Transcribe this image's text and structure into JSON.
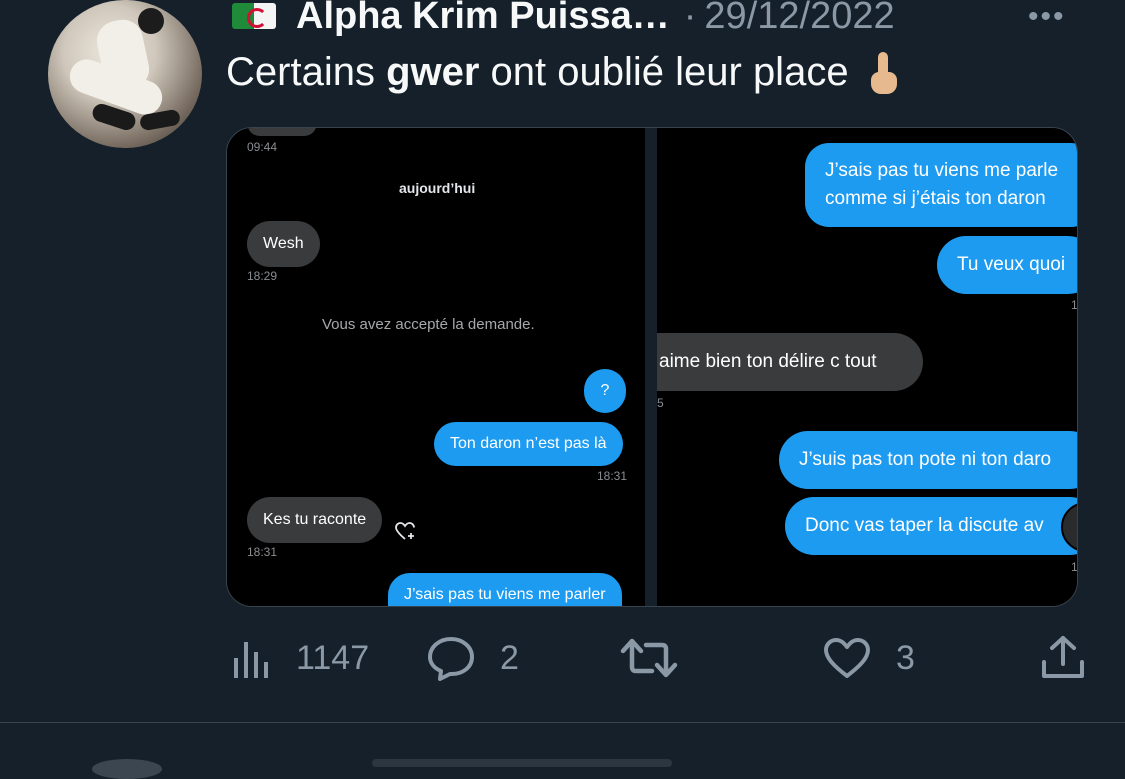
{
  "tweet": {
    "author_name": "Alpha Krim Puissa…",
    "separator": "·",
    "date": "29/12/2022",
    "more_label": "•••",
    "text_before": "Certains ",
    "text_bold": "gwer",
    "text_after": " ont oublié leur place",
    "emoji": "middle-finger-emoji"
  },
  "left_chat": {
    "top_time": "09:44",
    "day_label": "aujourd’hui",
    "msg_wesh": "Wesh",
    "time_wesh": "18:29",
    "system_msg": "Vous avez accepté la demande.",
    "msg_question": "?",
    "msg_daron": "Ton daron n’est pas là",
    "time_daron": "18:31",
    "msg_kes": "Kes tu raconte",
    "time_kes": "18:31",
    "msg_parler": "J’sais pas tu viens me parler"
  },
  "right_chat": {
    "msg_parler_line1": "J’sais pas tu viens me parle",
    "msg_parler_line2": "comme si j’étais ton daron",
    "msg_veux": "Tu veux quoi",
    "time_fragment_1": "1",
    "msg_delire": "aime bien ton délire c tout",
    "time_fragment_2": "5",
    "msg_pote": "J’suis pas ton pote ni ton daro",
    "msg_discute": "Donc vas taper la discute av",
    "time_fragment_3": "1"
  },
  "actions": {
    "views": "1147",
    "replies": "2",
    "likes": "3"
  },
  "colors": {
    "background": "#15202b",
    "outgoing_bubble": "#1d9bf0",
    "incoming_bubble": "#3a3b3c",
    "muted": "#8b98a5"
  }
}
